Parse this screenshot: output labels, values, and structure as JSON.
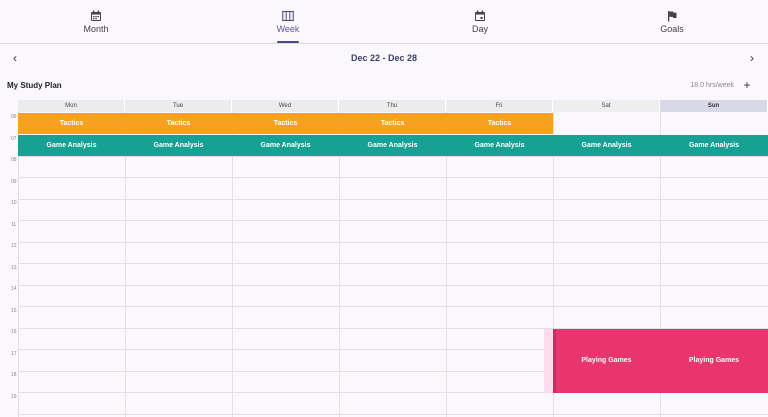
{
  "nav": {
    "tabs": [
      {
        "label": "Month",
        "icon": "calendar-month-icon"
      },
      {
        "label": "Week",
        "icon": "calendar-week-icon",
        "active": true
      },
      {
        "label": "Day",
        "icon": "calendar-day-icon"
      },
      {
        "label": "Goals",
        "icon": "flag-icon"
      }
    ]
  },
  "date_range": "Dec 22 - Dec 28",
  "plan": {
    "title": "My Study Plan",
    "hours": "18.0 hrs/week"
  },
  "days": [
    "Mon",
    "Tue",
    "Wed",
    "Thu",
    "Fri",
    "Sat",
    "Sun"
  ],
  "today": "Sun",
  "hours": [
    "06",
    "07",
    "08",
    "09",
    "10",
    "11",
    "12",
    "13",
    "14",
    "15",
    "16",
    "17",
    "18",
    "19"
  ],
  "events": {
    "tactics": "Tactics",
    "game_analysis": "Game Analysis",
    "playing_games": "Playing Games"
  },
  "colors": {
    "tactics": "#f8a022",
    "game_analysis": "#17a094",
    "playing_games": "#e8356f",
    "accent": "#4a4a8a"
  }
}
